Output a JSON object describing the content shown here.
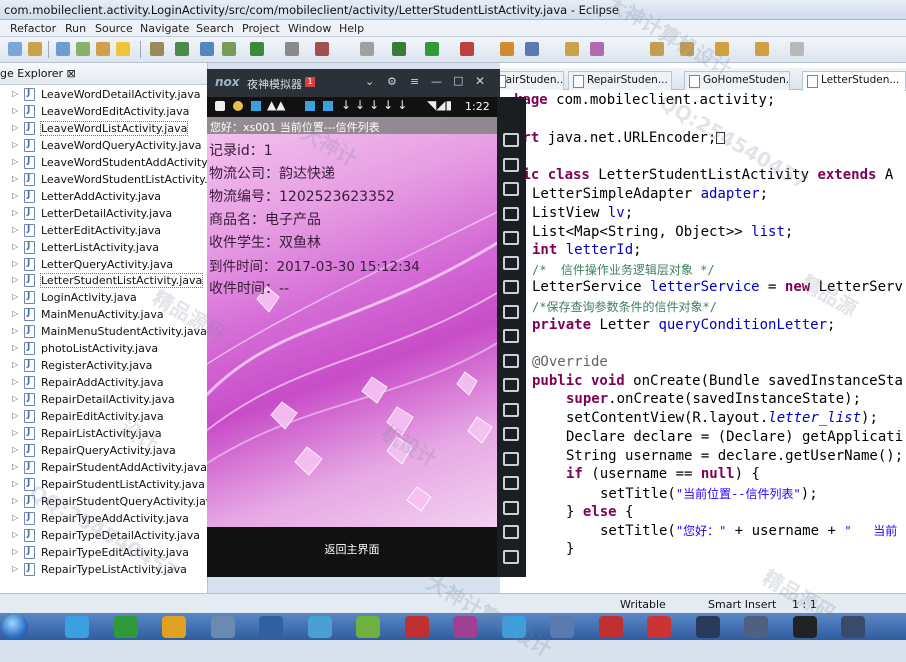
{
  "window": {
    "title": "com.mobileclient.activity.LoginActivity/src/com/mobileclient/activity/LetterStudentListActivity.java - Eclipse"
  },
  "menu": [
    "Refactor",
    "Run",
    "Source",
    "Navigate",
    "Search",
    "Project",
    "Window",
    "Help"
  ],
  "explorer": {
    "title": "ge Explorer ⊠",
    "files": [
      "LeaveWordDetailActivity.java",
      "LeaveWordEditActivity.java",
      "LeaveWordListActivity.java",
      "LeaveWordQueryActivity.java",
      "LeaveWordStudentAddActivity.java",
      "LeaveWordStudentListActivity.java",
      "LetterAddActivity.java",
      "LetterDetailActivity.java",
      "LetterEditActivity.java",
      "LetterListActivity.java",
      "LetterQueryActivity.java",
      "LetterStudentListActivity.java",
      "LoginActivity.java",
      "MainMenuActivity.java",
      "MainMenuStudentActivity.java",
      "photoListActivity.java",
      "RegisterActivity.java",
      "RepairAddActivity.java",
      "RepairDetailActivity.java",
      "RepairEditActivity.java",
      "RepairListActivity.java",
      "RepairQueryActivity.java",
      "RepairStudentAddActivity.java",
      "RepairStudentListActivity.java",
      "RepairStudentQueryActivity.java",
      "RepairTypeAddActivity.java",
      "RepairTypeDetailActivity.java",
      "RepairTypeEditActivity.java",
      "RepairTypeListActivity.java"
    ],
    "selected": [
      2,
      11
    ]
  },
  "tabs": [
    "pairStuden...",
    "RepairStuden...",
    "GoHomeStuden...",
    "LetterStuden..."
  ],
  "emulator": {
    "title": "夜神模拟器",
    "badge": "1",
    "clock": "1:22",
    "appbar": "您好：xs001  当前位置---信件列表",
    "record": [
      "记录id：1",
      "物流公司：韵达快递",
      "物流编号：1202523623352",
      "商品名：电子产品",
      "收件学生：双鱼林",
      "到件时间：2017-03-30 15:12:34",
      "收件时间：--"
    ],
    "back_button": "返回主界面"
  },
  "code": {
    "l1a": "kage ",
    "l1b": "com.mobileclient.activity;",
    "l2a": "ort ",
    "l2b": "java.net.URLEncoder;",
    "l3a": "lic class ",
    "l3b": "LetterStudentListActivity ",
    "l3c": "extends ",
    "l3d": "A",
    "l4a": "LetterSimpleAdapter ",
    "l4b": "adapter",
    "l5a": "ListView ",
    "l5b": "lv",
    "l6a": "List<Map<String, Object>> ",
    "l6b": "list",
    "l7a": "int ",
    "l7b": "letterId",
    "l8": "/*  信件操作业务逻辑层对象 */",
    "l9a": "LetterService ",
    "l9b": "letterService",
    "l9c": " = ",
    "l9d": "new ",
    "l9e": "LetterServ",
    "l10": "/*保存查询参数条件的信件对象*/",
    "l11a": "private ",
    "l11b": "Letter ",
    "l11c": "queryConditionLetter",
    "l12": "@Override",
    "l13a": "public void ",
    "l13b": "onCreate(Bundle savedInstanceSta",
    "l14a": "super",
    "l14b": ".onCreate(savedInstanceState);",
    "l15a": "setContentView(R.layout.",
    "l15b": "letter_list",
    "l15c": ");",
    "l16": "Declare declare = (Declare) getApplicati",
    "l17": "String username = declare.getUserName();",
    "l18a": "if ",
    "l18b": "(username == ",
    "l18c": "null",
    "l18d": ") {",
    "l19a": "setTitle(",
    "l19b": "\"当前位置--信件列表\"",
    "l19c": ");",
    "l20a": "} ",
    "l20b": "else ",
    "l20c": "{",
    "l21a": "setTitle(",
    "l21b": "\"您好：\"",
    "l21c": " + username + ",
    "l21d": "\"   当前",
    "l22": "}"
  },
  "status": {
    "writable": "Writable",
    "insert": "Smart Insert",
    "pos": "1 : 1"
  },
  "watermarks": [
    "大神计算机设计",
    "QQ:254540457",
    "精品源码",
    "设计",
    "大神计",
    "机设计",
    "精品源"
  ]
}
